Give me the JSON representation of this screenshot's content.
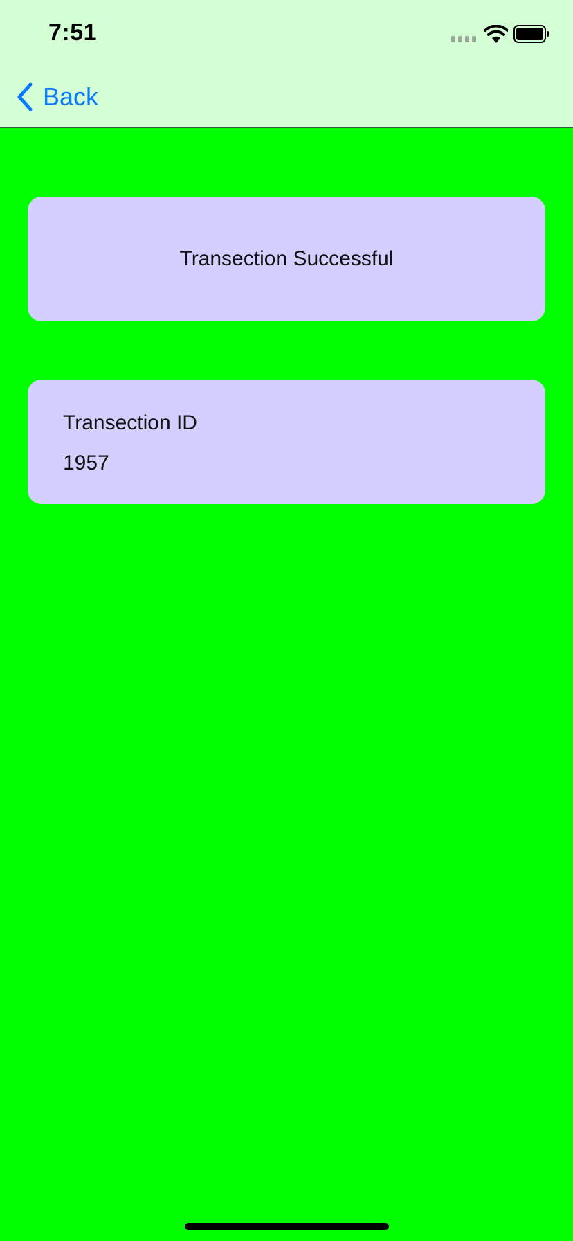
{
  "status_bar": {
    "time": "7:51"
  },
  "nav": {
    "back_label": "Back",
    "back_icon": "chevron-left-icon"
  },
  "status_card": {
    "message": "Transection Successful"
  },
  "transaction": {
    "label": "Transection ID",
    "value": "1957"
  },
  "colors": {
    "background": "#00ff00",
    "nav_background": "#d4ffd4",
    "card": "#d3d0ff",
    "accent": "#0a7bff"
  }
}
